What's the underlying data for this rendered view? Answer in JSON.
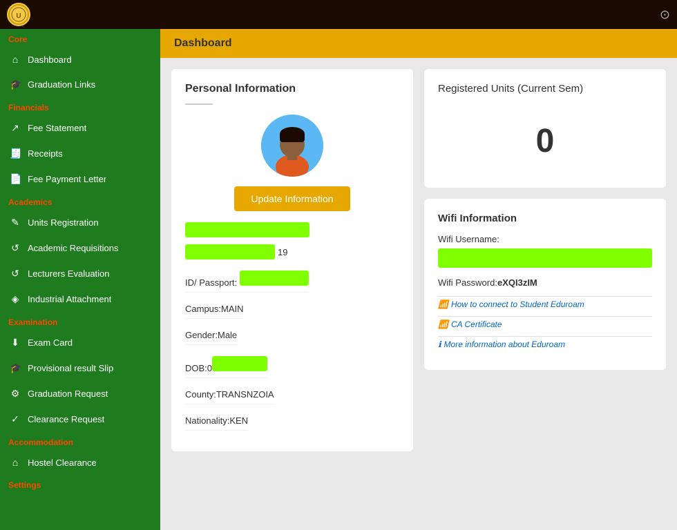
{
  "topbar": {
    "logo_text": "U",
    "toggle_label": "toggle sidebar"
  },
  "sidebar": {
    "sections": [
      {
        "label": "Core",
        "items": [
          {
            "id": "dashboard",
            "label": "Dashboard",
            "icon": "⌂"
          },
          {
            "id": "graduation-links",
            "label": "Graduation Links",
            "icon": "🎓"
          }
        ]
      },
      {
        "label": "Financials",
        "items": [
          {
            "id": "fee-statement",
            "label": "Fee Statement",
            "icon": "↗"
          },
          {
            "id": "receipts",
            "label": "Receipts",
            "icon": "🧾"
          },
          {
            "id": "fee-payment-letter",
            "label": "Fee Payment Letter",
            "icon": "📄"
          }
        ]
      },
      {
        "label": "Academics",
        "items": [
          {
            "id": "units-registration",
            "label": "Units Registration",
            "icon": "✎"
          },
          {
            "id": "academic-requisitions",
            "label": "Academic Requisitions",
            "icon": "↺"
          },
          {
            "id": "lecturers-evaluation",
            "label": "Lecturers Evaluation",
            "icon": "↺"
          },
          {
            "id": "industrial-attachment",
            "label": "Industrial Attachment",
            "icon": "◈"
          }
        ]
      },
      {
        "label": "Examination",
        "items": [
          {
            "id": "exam-card",
            "label": "Exam Card",
            "icon": "⬇"
          },
          {
            "id": "provisional-result-slip",
            "label": "Provisional result Slip",
            "icon": "🎓"
          },
          {
            "id": "graduation-request",
            "label": "Graduation Request",
            "icon": "⚙"
          },
          {
            "id": "clearance-request",
            "label": "Clearance Request",
            "icon": "✓"
          }
        ]
      },
      {
        "label": "Accommodation",
        "items": [
          {
            "id": "hostel-clearance",
            "label": "Hostel Clearance",
            "icon": "⌂"
          }
        ]
      },
      {
        "label": "Settings",
        "items": []
      }
    ]
  },
  "header": {
    "title": "Dashboard"
  },
  "personal_info": {
    "title": "Personal Information",
    "update_btn_label": "Update Information",
    "name_redacted": true,
    "year_suffix": "19",
    "id_label": "ID/ Passport:",
    "campus_label": "Campus:",
    "campus_value": "MAIN",
    "gender_label": "Gender:",
    "gender_value": "Male",
    "dob_label": "DOB:",
    "dob_prefix": "0",
    "county_label": "County:",
    "county_value": "TRANSNZOIA",
    "nationality_label": "Nationality:",
    "nationality_value": "KEN"
  },
  "registered_units": {
    "title": "Registered Units (Current Sem)",
    "value": "0"
  },
  "wifi_info": {
    "title": "Wifi Information",
    "username_label": "Wifi Username:",
    "password_label": "Wifi Password:",
    "password_value": "eXQI3zIM",
    "link1": "How to connect to Student Eduroam",
    "link2": "CA Certificate",
    "link3": "More information about Eduroam"
  }
}
